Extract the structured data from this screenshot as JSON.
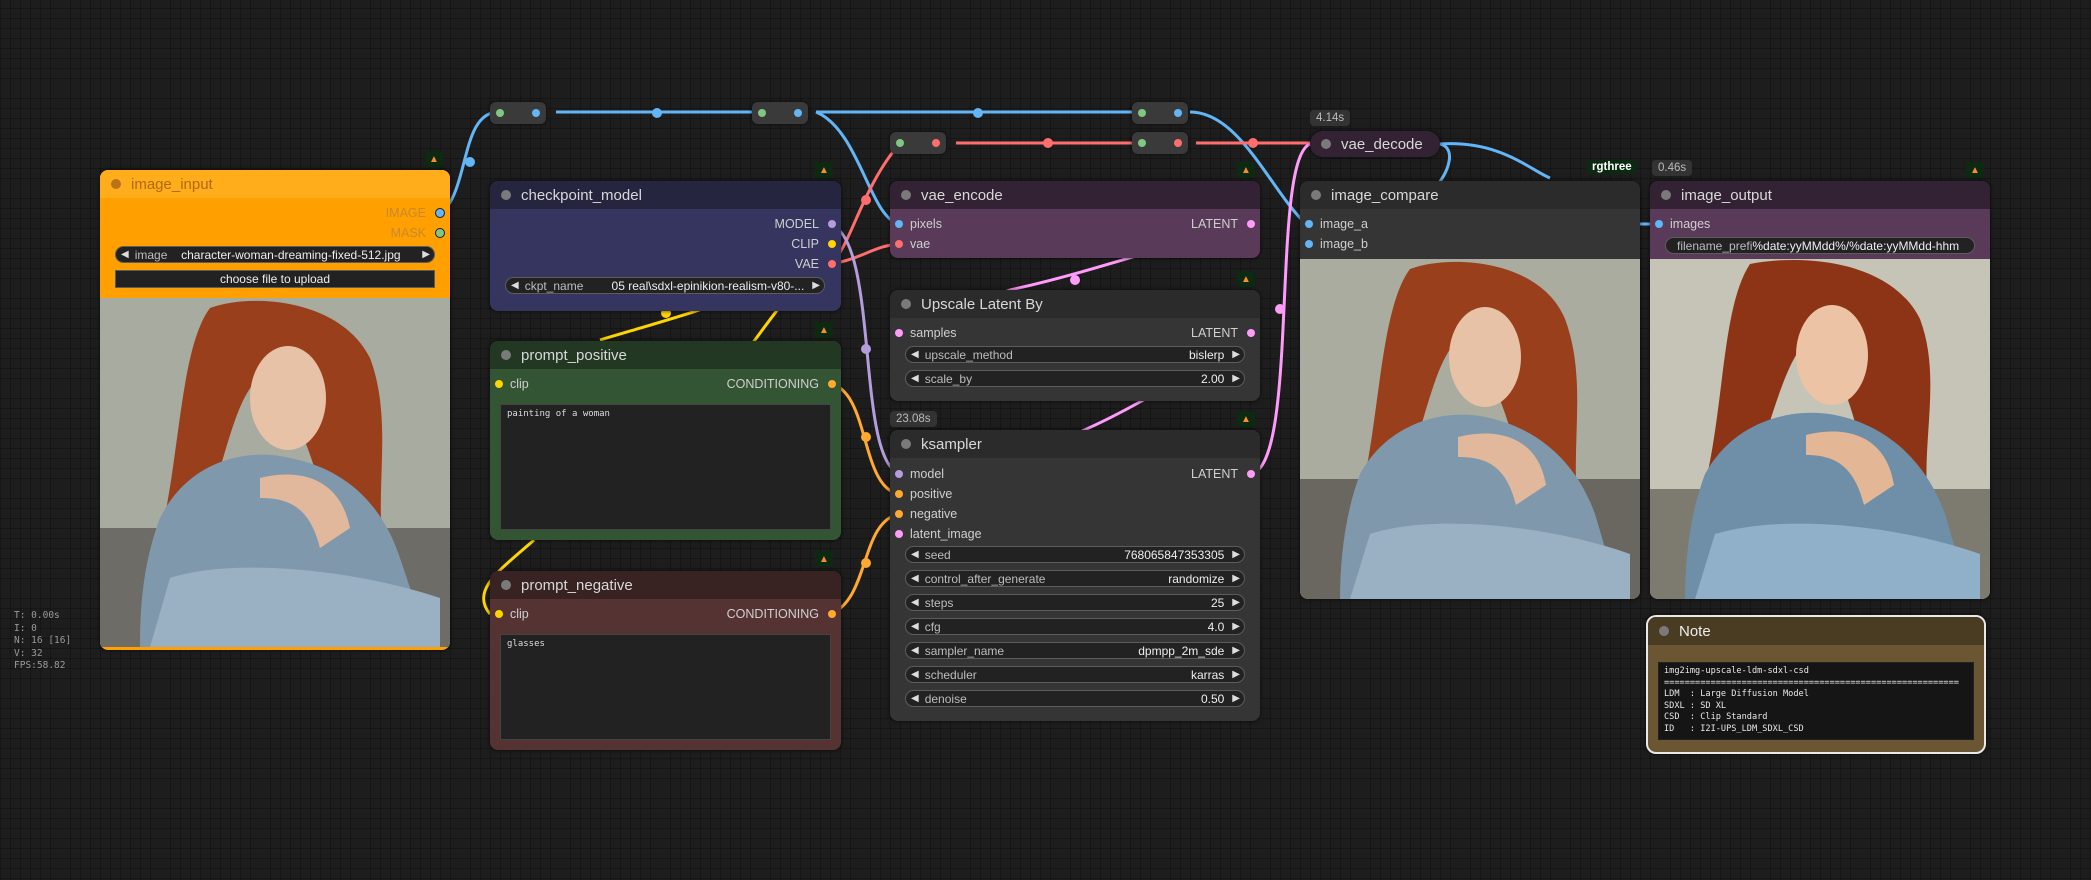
{
  "colors": {
    "model": "#b39ddb",
    "clip": "#ffd500",
    "vae": "#ff6e6e",
    "latent": "#ff9cf9",
    "image": "#64b5f6",
    "conditioning": "#ffa931",
    "mask": "#81c784"
  },
  "nodes": {
    "image_input": {
      "title": "image_input",
      "outputs": [
        "IMAGE",
        "MASK"
      ],
      "image_widget": {
        "label": "image",
        "value": "character-woman-dreaming-fixed-512.jpg"
      },
      "upload_button": "choose file to upload"
    },
    "checkpoint_model": {
      "title": "checkpoint_model",
      "outputs": [
        "MODEL",
        "CLIP",
        "VAE"
      ],
      "ckpt_widget": {
        "label": "ckpt_name",
        "value": "05 real\\sdxl-epinikion-realism-v80-..."
      }
    },
    "prompt_positive": {
      "title": "prompt_positive",
      "input": "clip",
      "output": "CONDITIONING",
      "text": "painting of a woman"
    },
    "prompt_negative": {
      "title": "prompt_negative",
      "input": "clip",
      "output": "CONDITIONING",
      "text": "glasses"
    },
    "vae_encode": {
      "title": "vae_encode",
      "inputs": [
        "pixels",
        "vae"
      ],
      "output": "LATENT"
    },
    "upscale_latent": {
      "title": "Upscale Latent By",
      "input": "samples",
      "output": "LATENT",
      "widgets": [
        {
          "label": "upscale_method",
          "value": "bislerp"
        },
        {
          "label": "scale_by",
          "value": "2.00"
        }
      ]
    },
    "ksampler": {
      "title": "ksampler",
      "badge": "23.08s",
      "inputs": [
        "model",
        "positive",
        "negative",
        "latent_image"
      ],
      "output": "LATENT",
      "widgets": [
        {
          "label": "seed",
          "value": "768065847353305"
        },
        {
          "label": "control_after_generate",
          "value": "randomize"
        },
        {
          "label": "steps",
          "value": "25"
        },
        {
          "label": "cfg",
          "value": "4.0"
        },
        {
          "label": "sampler_name",
          "value": "dpmpp_2m_sde"
        },
        {
          "label": "scheduler",
          "value": "karras"
        },
        {
          "label": "denoise",
          "value": "0.50"
        }
      ]
    },
    "vae_decode": {
      "title": "vae_decode",
      "badge": "4.14s"
    },
    "image_compare": {
      "title": "image_compare",
      "inputs": [
        "image_a",
        "image_b"
      ],
      "badge": "rgthree"
    },
    "image_output": {
      "title": "image_output",
      "badge": "0.46s",
      "input": "images",
      "prefix_widget": {
        "label": "filename_prefi",
        "value": "%date:yyMMdd%/%date:yyMMdd-hhm"
      }
    },
    "note": {
      "title": "Note",
      "text": "img2img-upscale-ldm-sdxl-csd\n=========================================================\nLDM  : Large Diffusion Model\nSDXL : SD XL\nCSD  : Clip Standard\nID   : I2I-UPS_LDM_SDXL_CSD"
    }
  },
  "stats": [
    "T: 0.00s",
    "I: 0",
    "N: 16 [16]",
    "V: 32",
    "FPS:58.82"
  ],
  "node_icon": "fox-icon"
}
